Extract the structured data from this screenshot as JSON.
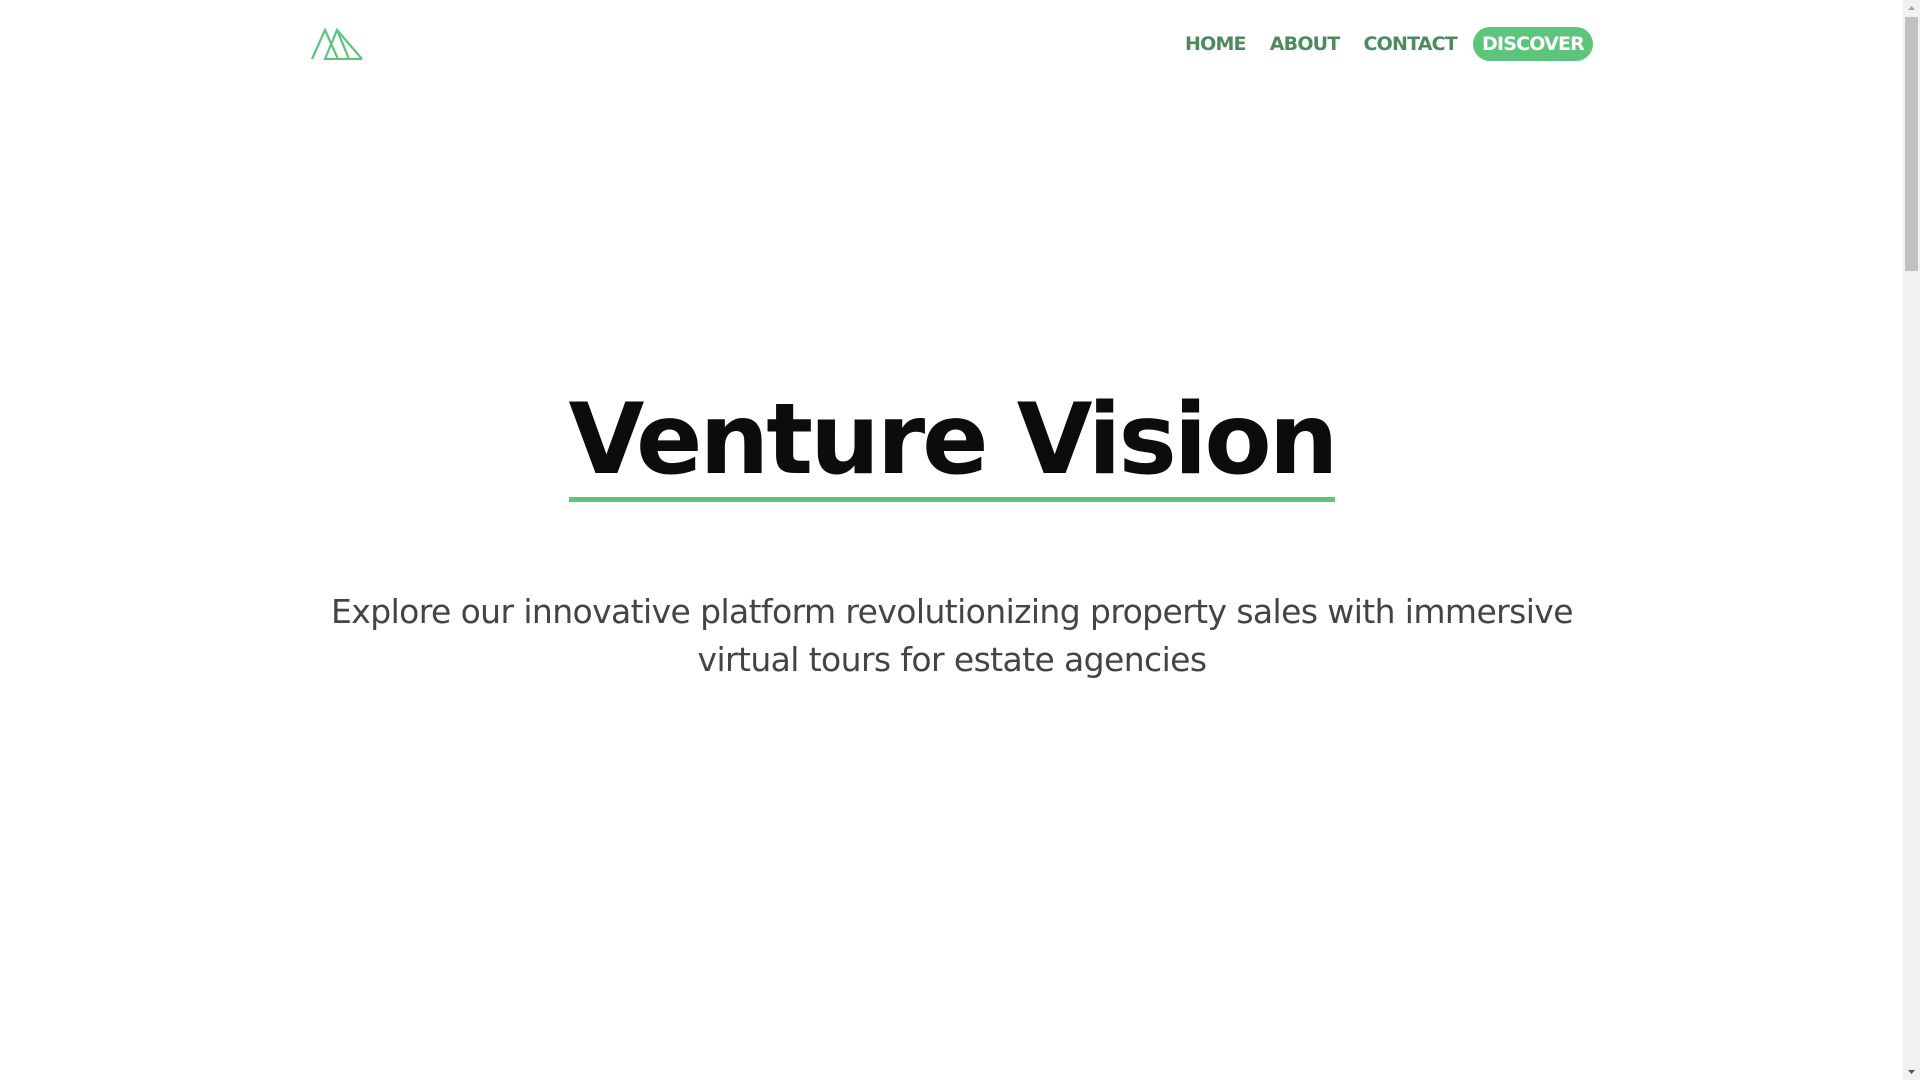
{
  "header": {
    "logo_icon": "mountains-logo-icon",
    "nav": {
      "home": "HOME",
      "about": "ABOUT",
      "contact": "CONTACT",
      "discover": "DISCOVER"
    }
  },
  "hero": {
    "title": "Venture Vision",
    "subtitle": "Explore our innovative platform revolutionizing property sales with immersive virtual tours for estate agencies"
  },
  "colors": {
    "accent": "#5cc47b",
    "nav_text": "#4d8a5e",
    "title_text": "#0c0c0c",
    "subtitle_text": "#444444"
  },
  "scrollbar": {
    "up_icon": "arrow-up-icon",
    "down_icon": "arrow-down-icon"
  }
}
